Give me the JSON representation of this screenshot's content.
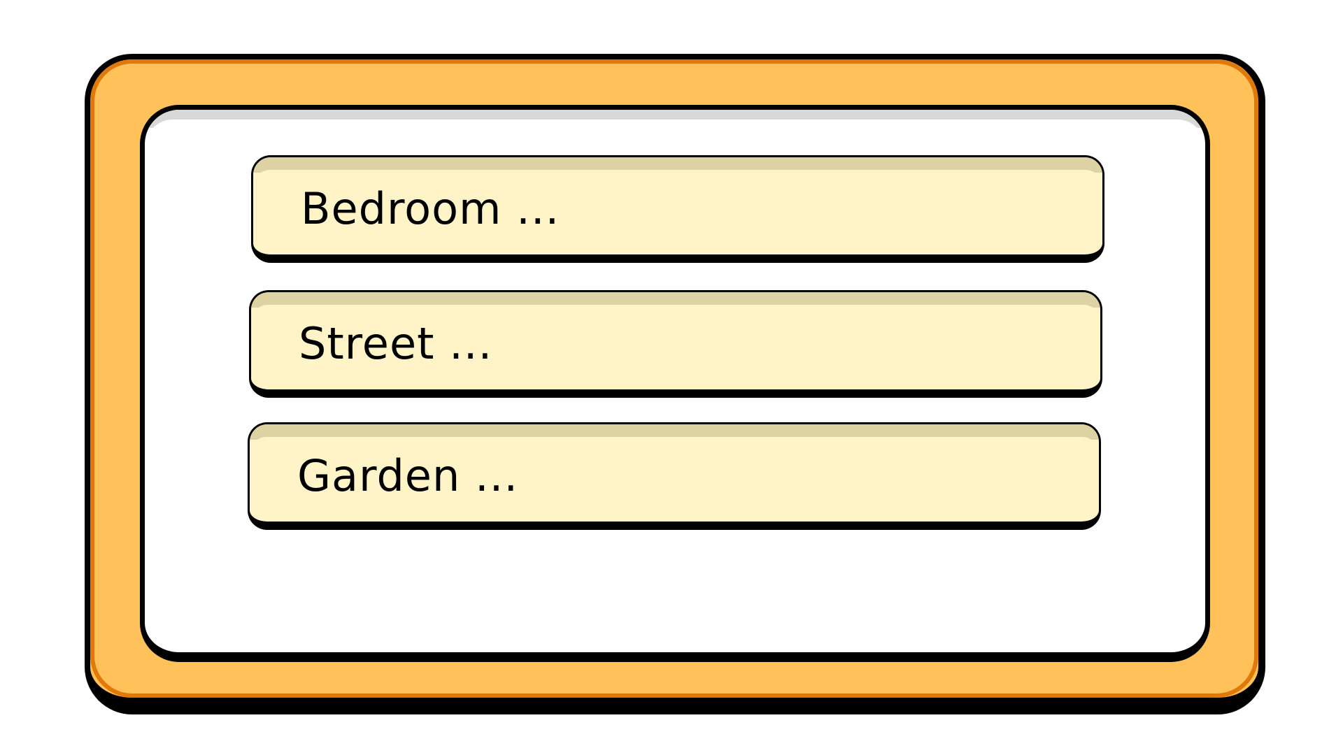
{
  "colors": {
    "frame_fill": "#FFC15A",
    "frame_inner_edge": "#E0780A",
    "outline": "#000000",
    "panel_fill": "#FFFFFF",
    "panel_shade": "#D8D8D8",
    "option_fill": "#FFF4C8",
    "option_shade": "#DDD2A2"
  },
  "choices": [
    {
      "label": "Bedroom ..."
    },
    {
      "label": "Street ..."
    },
    {
      "label": "Garden ..."
    }
  ]
}
